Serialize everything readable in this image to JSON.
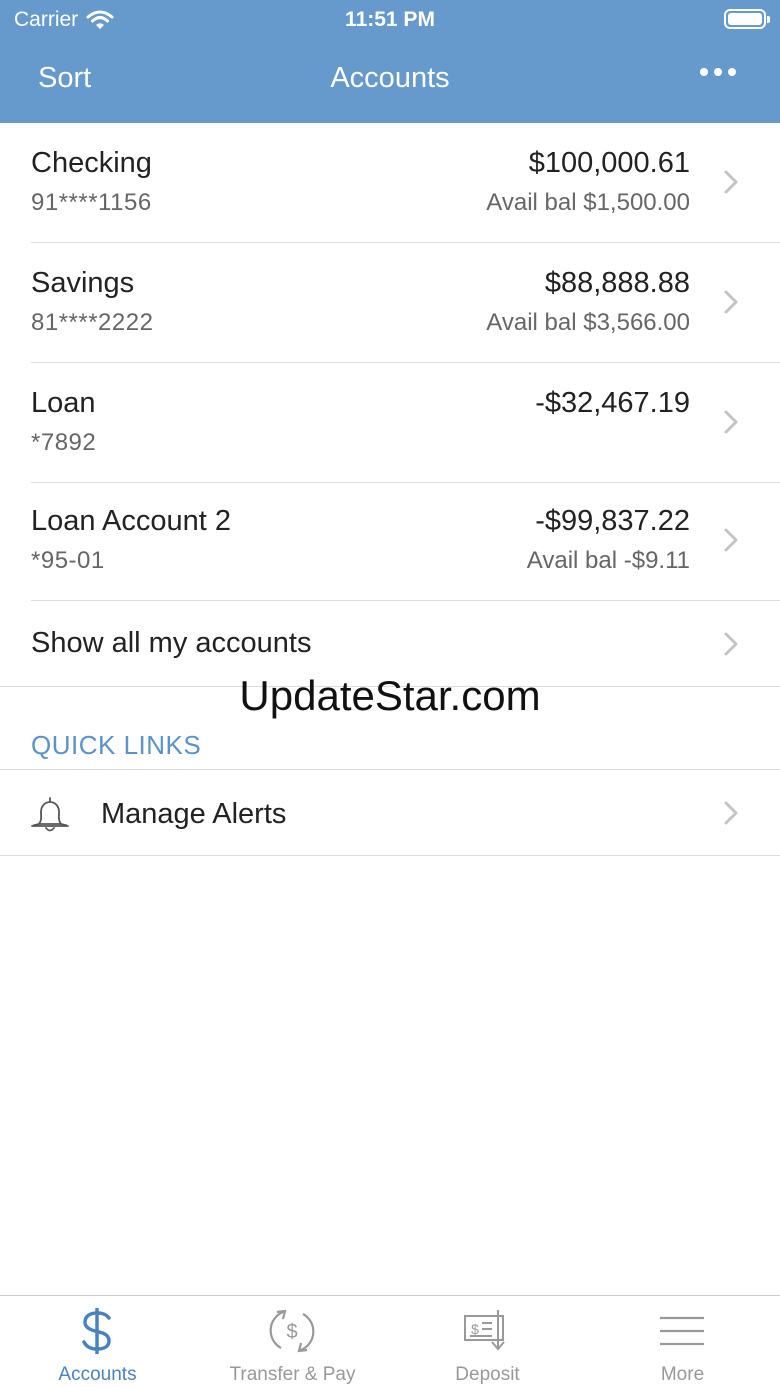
{
  "status_bar": {
    "carrier": "Carrier",
    "time": "11:51 PM"
  },
  "nav": {
    "left_label": "Sort",
    "title": "Accounts",
    "right_icon": "more-horizontal-icon"
  },
  "accounts": [
    {
      "name": "Checking",
      "number": "91****1156",
      "balance": "$100,000.61",
      "avail": "Avail bal $1,500.00"
    },
    {
      "name": "Savings",
      "number": "81****2222",
      "balance": "$88,888.88",
      "avail": "Avail bal $3,566.00"
    },
    {
      "name": "Loan",
      "number": "*7892",
      "balance": "-$32,467.19",
      "avail": ""
    },
    {
      "name": "Loan Account 2",
      "number": "*95-01",
      "balance": "-$99,837.22",
      "avail": "Avail bal -$9.11"
    }
  ],
  "show_all": {
    "label": "Show all my accounts"
  },
  "watermark": "UpdateStar.com",
  "quick_links": {
    "header": "QUICK LINKS",
    "items": [
      {
        "label": "Manage Alerts",
        "icon": "bell-icon"
      }
    ]
  },
  "tab_bar": {
    "tabs": [
      {
        "label": "Accounts",
        "icon": "dollar-icon",
        "active": true
      },
      {
        "label": "Transfer & Pay",
        "icon": "transfer-icon",
        "active": false
      },
      {
        "label": "Deposit",
        "icon": "deposit-check-icon",
        "active": false
      },
      {
        "label": "More",
        "icon": "menu-icon",
        "active": false
      }
    ]
  },
  "colors": {
    "header_bg": "#6699cc",
    "accent": "#4a82bf",
    "section_header": "#5b93c9"
  }
}
